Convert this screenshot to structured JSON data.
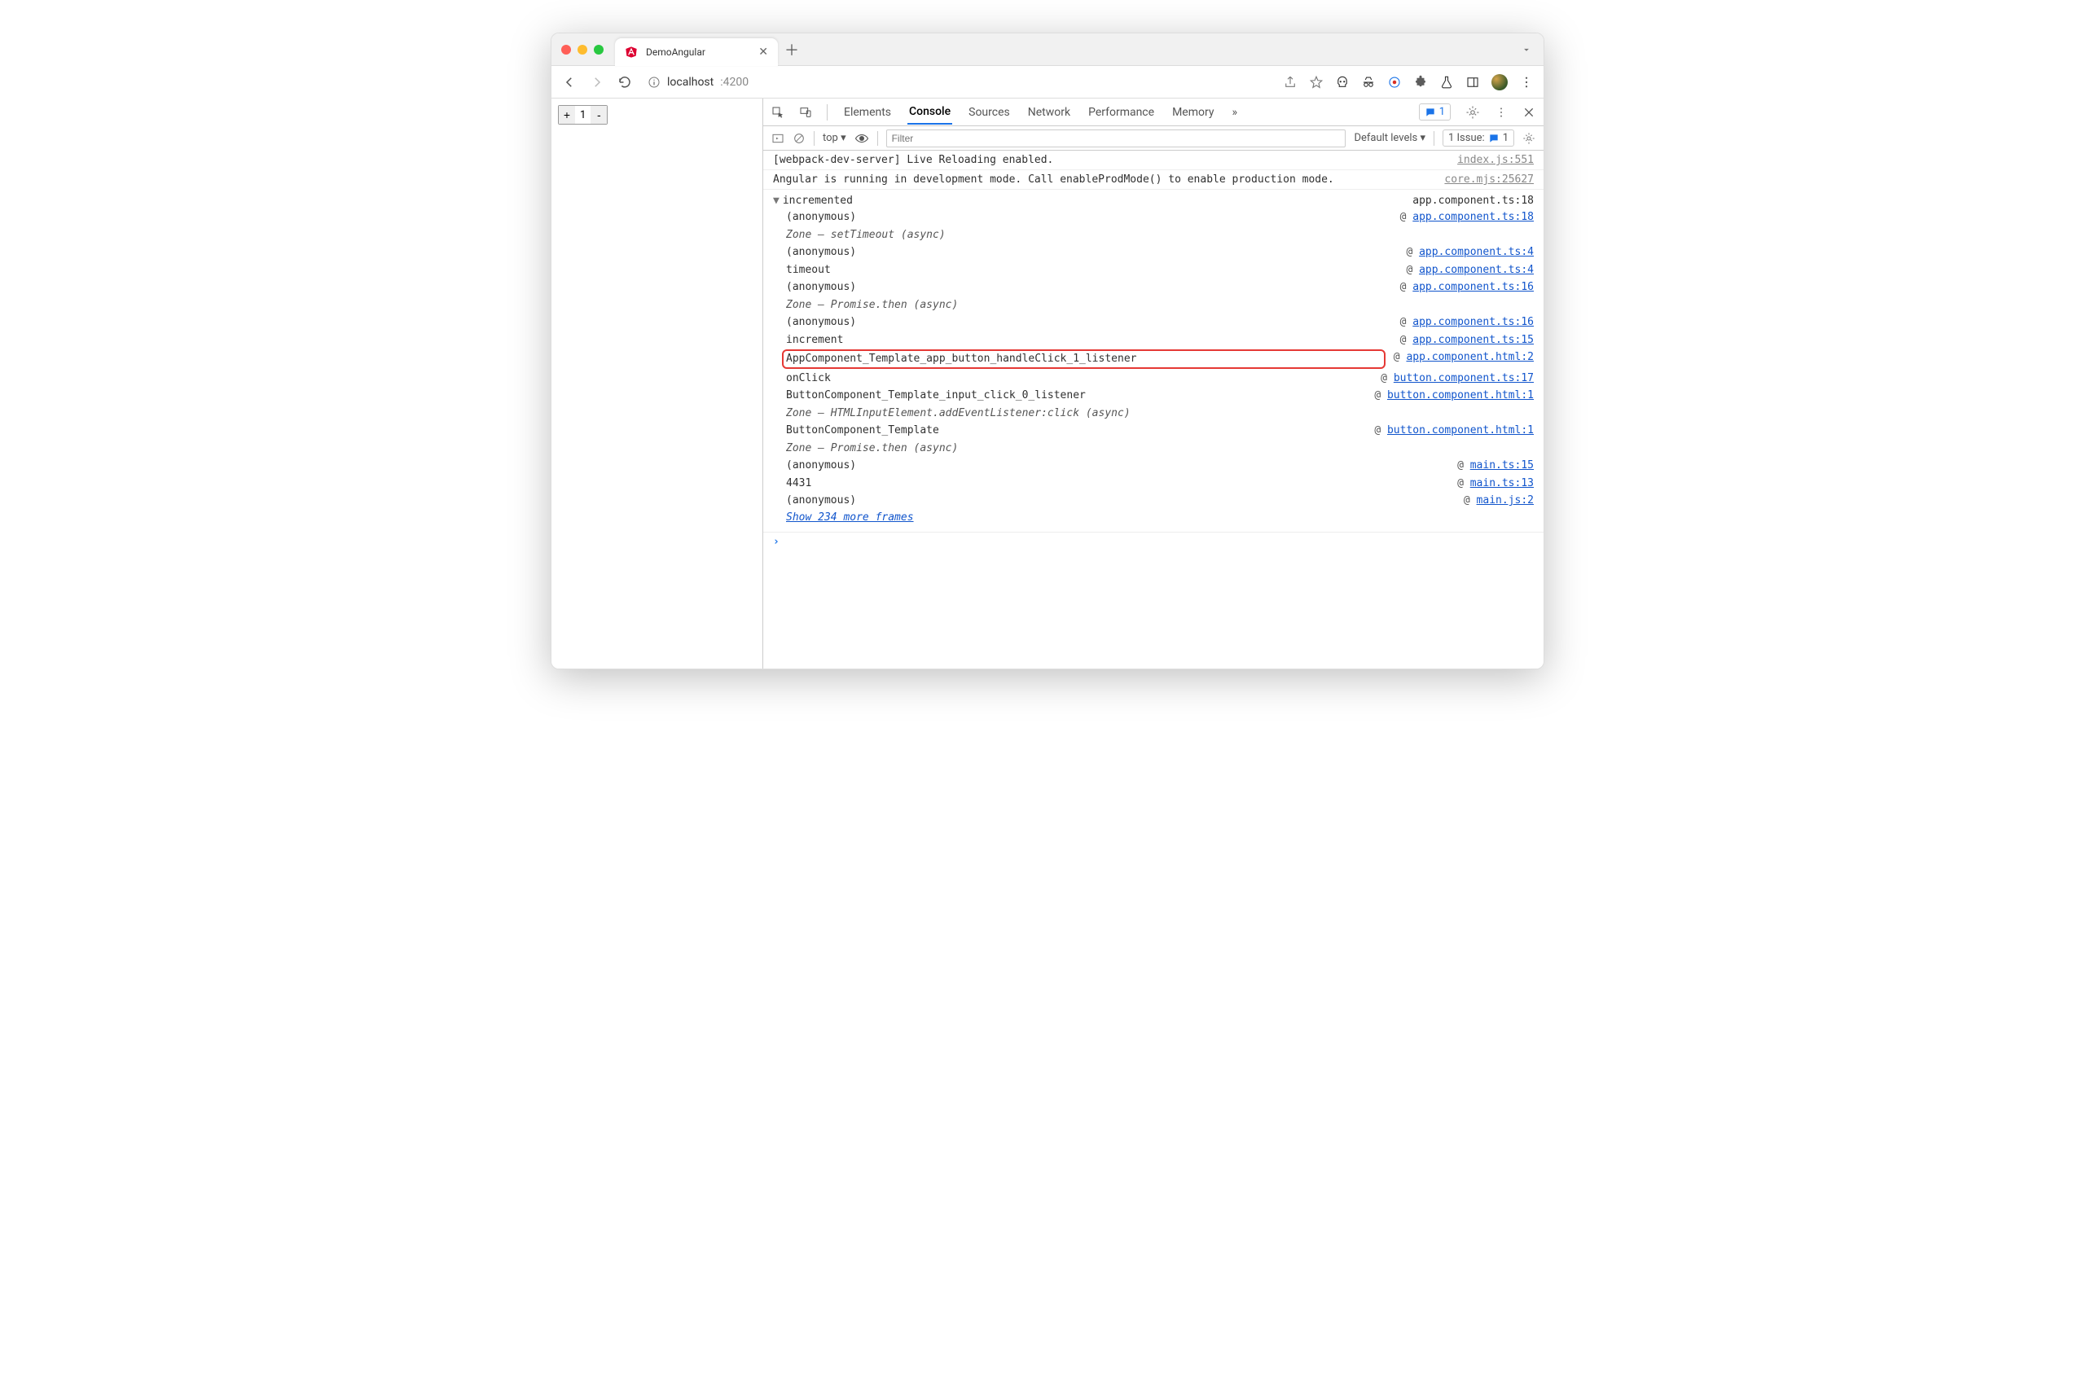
{
  "browser": {
    "tab_title": "DemoAngular",
    "url_host": "localhost",
    "url_port": ":4200"
  },
  "page": {
    "counter_value": "1",
    "plus": "+",
    "minus": "-"
  },
  "devtools": {
    "tabs": [
      "Elements",
      "Console",
      "Sources",
      "Network",
      "Performance",
      "Memory"
    ],
    "active_tab": "Console",
    "overflow": "»",
    "issues_badge_count": "1",
    "context": "top ▾",
    "filter_placeholder": "Filter",
    "levels": "Default levels ▾",
    "issue_pill_label": "1 Issue:",
    "issue_pill_count": "1"
  },
  "console": {
    "lines": [
      {
        "msg": "[webpack-dev-server] Live Reloading enabled.",
        "src": "index.js:551"
      },
      {
        "msg": "Angular is running in development mode. Call enableProdMode() to enable production mode.",
        "src": "core.mjs:25627"
      }
    ],
    "trace": {
      "label": "incremented",
      "right_src": "app.component.ts:18",
      "rows": [
        {
          "fn": "(anonymous)",
          "link": "app.component.ts:18"
        },
        {
          "fn": "Zone — setTimeout (async)",
          "italic": true
        },
        {
          "fn": "(anonymous)",
          "link": "app.component.ts:4"
        },
        {
          "fn": "timeout",
          "link": "app.component.ts:4"
        },
        {
          "fn": "(anonymous)",
          "link": "app.component.ts:16"
        },
        {
          "fn": "Zone — Promise.then (async)",
          "italic": true
        },
        {
          "fn": "(anonymous)",
          "link": "app.component.ts:16"
        },
        {
          "fn": "increment",
          "link": "app.component.ts:15"
        },
        {
          "fn": "AppComponent_Template_app_button_handleClick_1_listener",
          "link": "app.component.html:2",
          "highlight": true
        },
        {
          "fn": "onClick",
          "link": "button.component.ts:17"
        },
        {
          "fn": "ButtonComponent_Template_input_click_0_listener",
          "link": "button.component.html:1"
        },
        {
          "fn": "Zone — HTMLInputElement.addEventListener:click (async)",
          "italic": true
        },
        {
          "fn": "ButtonComponent_Template",
          "link": "button.component.html:1"
        },
        {
          "fn": "Zone — Promise.then (async)",
          "italic": true
        },
        {
          "fn": "(anonymous)",
          "link": "main.ts:15"
        },
        {
          "fn": "4431",
          "link": "main.ts:13"
        },
        {
          "fn": "(anonymous)",
          "link": "main.js:2"
        }
      ],
      "show_more": "Show 234 more frames"
    },
    "prompt": "›"
  }
}
